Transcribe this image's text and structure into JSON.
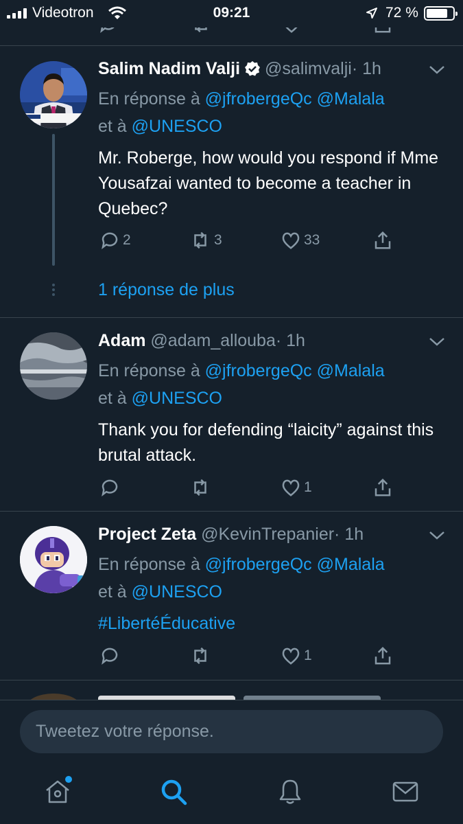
{
  "status_bar": {
    "carrier": "Videotron",
    "time": "09:21",
    "battery_percent": "72 %",
    "battery_level": 0.72
  },
  "tweets": [
    {
      "name": "Salim Nadim Valji",
      "verified": true,
      "handle": "@salimvalji",
      "time": "· 1h",
      "reply_prefix": "En réponse à",
      "reply_mentions": [
        "@jfrobergeQc",
        "@Malala"
      ],
      "reply_joiner": "et à",
      "reply_last": "@UNESCO",
      "text": "Mr. Roberge, how would you respond if Mme Yousafzai wanted to become a teacher in Quebec?",
      "replies": "2",
      "retweets": "3",
      "likes": "33",
      "more_replies": "1 réponse de plus"
    },
    {
      "name": "Adam",
      "handle": "@adam_allouba",
      "time": "· 1h",
      "reply_prefix": "En réponse à",
      "reply_mentions": [
        "@jfrobergeQc",
        "@Malala"
      ],
      "reply_joiner": "et à",
      "reply_last": "@UNESCO",
      "text": "Thank you for defending “laicity” against this brutal attack.",
      "likes": "1"
    },
    {
      "name": "Project Zeta",
      "handle": "@KevinTrepanier",
      "time": "· 1h",
      "reply_prefix": "En réponse à",
      "reply_mentions": [
        "@jfrobergeQc",
        "@Malala"
      ],
      "reply_joiner": "et à",
      "reply_last": "@UNESCO",
      "text": "#LibertéÉducative",
      "likes": "1"
    }
  ],
  "compose": {
    "placeholder": "Tweetez votre réponse."
  },
  "colors": {
    "background": "#15202b",
    "accent": "#1da1f2",
    "muted": "#8899a6",
    "divider": "#38444d"
  },
  "icons": [
    "home-icon",
    "search-icon",
    "notifications-icon",
    "messages-icon",
    "reply-icon",
    "retweet-icon",
    "like-icon",
    "share-icon",
    "chevron-down-icon",
    "verified-badge-icon"
  ]
}
